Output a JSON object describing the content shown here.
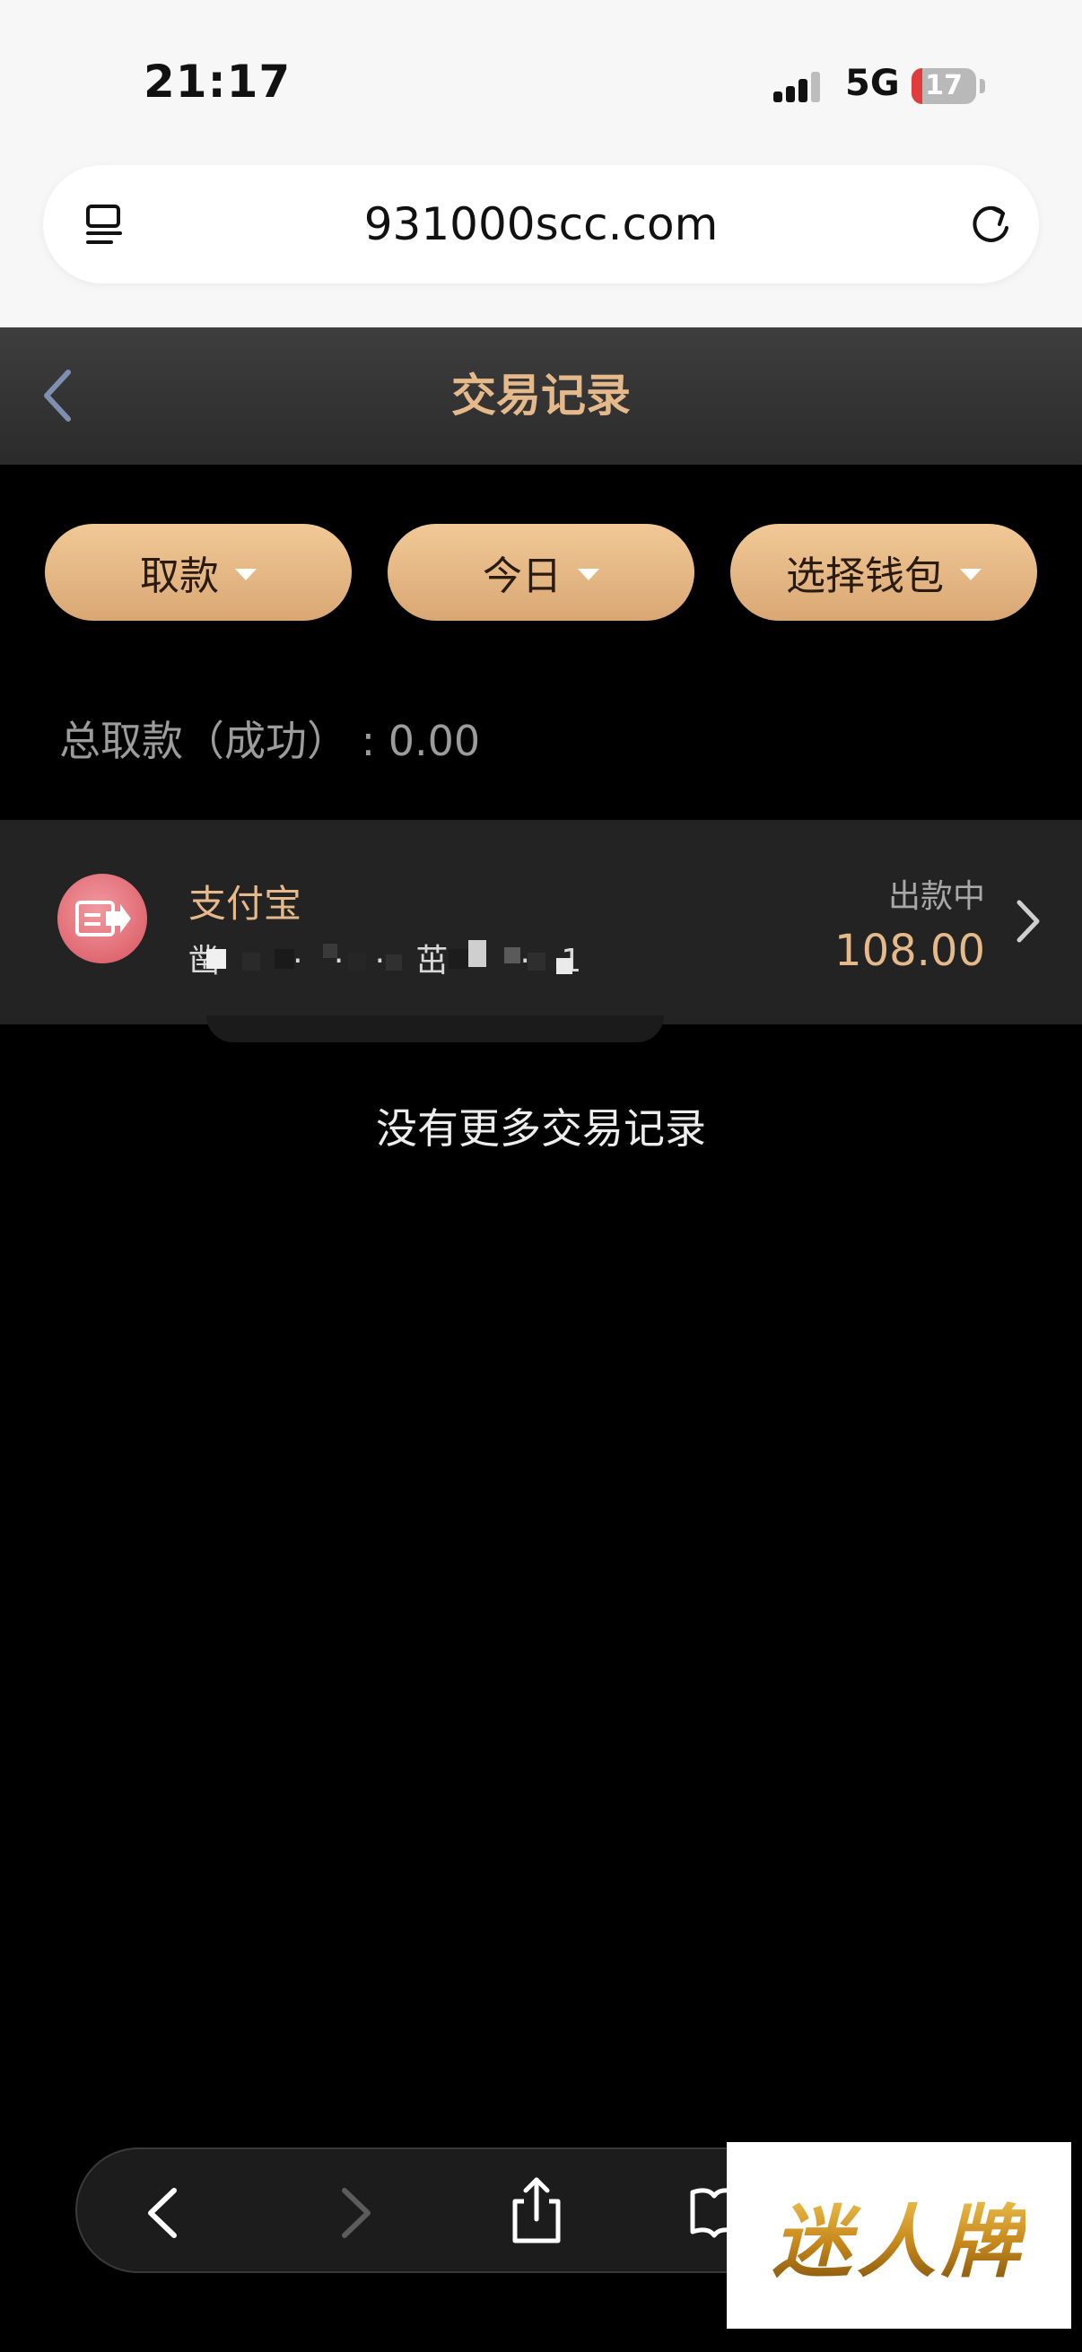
{
  "status_bar": {
    "time": "21:17",
    "network": "5G",
    "battery": "17",
    "battery_level": 0.17
  },
  "browser": {
    "url": "931000scc.com"
  },
  "header": {
    "title": "交易记录"
  },
  "filters": [
    {
      "label": "取款"
    },
    {
      "label": "今日"
    },
    {
      "label": "选择钱包"
    }
  ],
  "summary": {
    "label": "总取款（成功）",
    "separator": ":",
    "value": "0.00"
  },
  "transactions": [
    {
      "name": "支付宝",
      "account": "凿   ·   ·   ·   ·   茁   ·   ·   1",
      "status": "出款中",
      "amount": "108.00"
    }
  ],
  "list_end": "没有更多交易记录",
  "watermark": "迷人牌",
  "colors": {
    "accent": "#e6b98a",
    "pill": "#e0b07c",
    "row_bg": "#232323"
  }
}
